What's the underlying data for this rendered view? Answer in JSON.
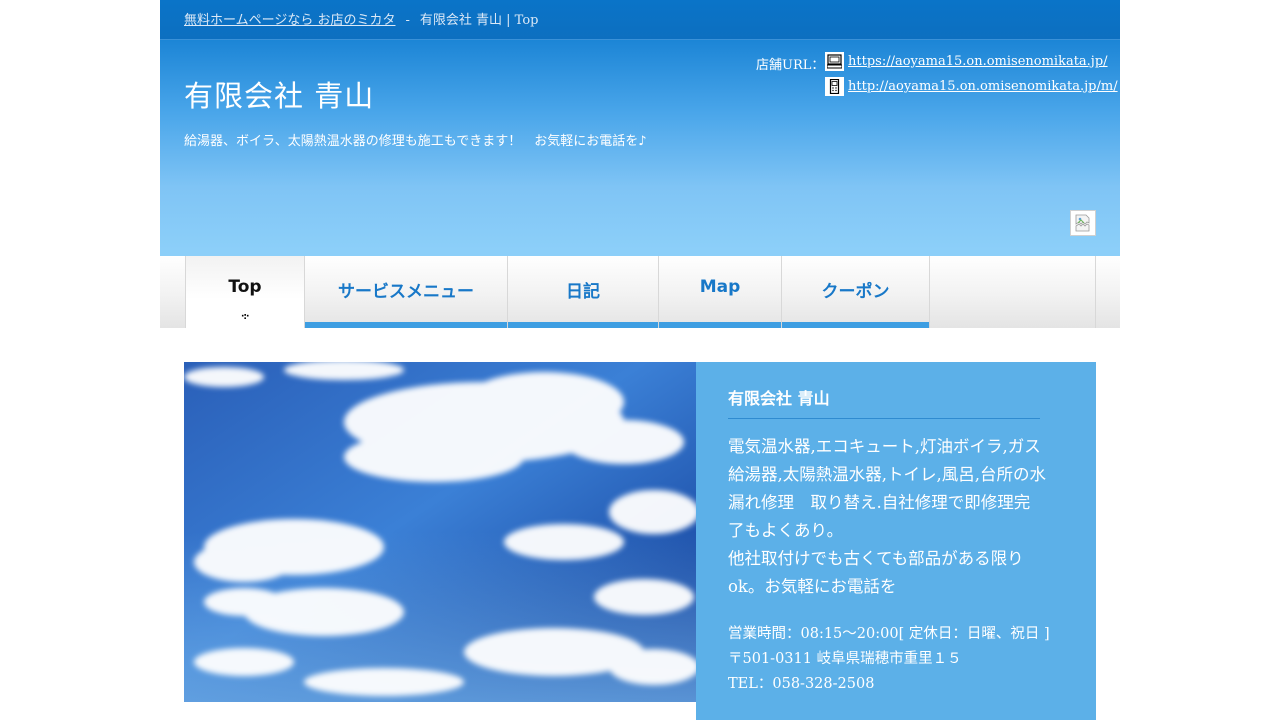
{
  "topbar": {
    "link_text": "無料ホームページなら お店のミカタ",
    "separator": "-",
    "page_title": "有限会社 青山 | Top"
  },
  "header": {
    "site_title": "有限会社 青山",
    "tagline": "給湯器、ボイラ、太陽熱温水器の修理も施工もできます！　お気軽にお電話を♪",
    "url_label": "店舗URL：",
    "pc_url": "https://aoyama15.on.omisenomikata.jp/",
    "mobile_url": "http://aoyama15.on.omisenomikata.jp/m/",
    "icons": [
      "pc-icon",
      "mobile-phone-icon",
      "broken-image-icon"
    ]
  },
  "nav": {
    "items": [
      {
        "label": "Top",
        "active": true
      },
      {
        "label": "サービスメニュー",
        "active": false
      },
      {
        "label": "日記",
        "active": false
      },
      {
        "label": "Map",
        "active": false
      },
      {
        "label": "クーポン",
        "active": false
      }
    ]
  },
  "main": {
    "hero_image": "blue-sky-clouds",
    "shop_name": "有限会社 青山",
    "description_1": "電気温水器,エコキュート,灯油ボイラ,ガス給湯器,太陽熱温水器,トイレ,風呂,台所の水漏れ修理　取り替え.自社修理で即修理完了もよくあり。",
    "description_2": "他社取付けでも古くても部品がある限りok。お気軽にお電話を",
    "hours": "営業時間：08:15〜20:00[ 定休日：日曜、祝日 ]",
    "address": "〒501-0311 岐阜県瑞穂市重里１５",
    "tel": "TEL：058-328-2508"
  },
  "colors": {
    "topbar": "#0a74c8",
    "header_light": "#8ccff9",
    "nav_accent": "#3d9ee2",
    "info_bg": "#5cb0e8"
  }
}
